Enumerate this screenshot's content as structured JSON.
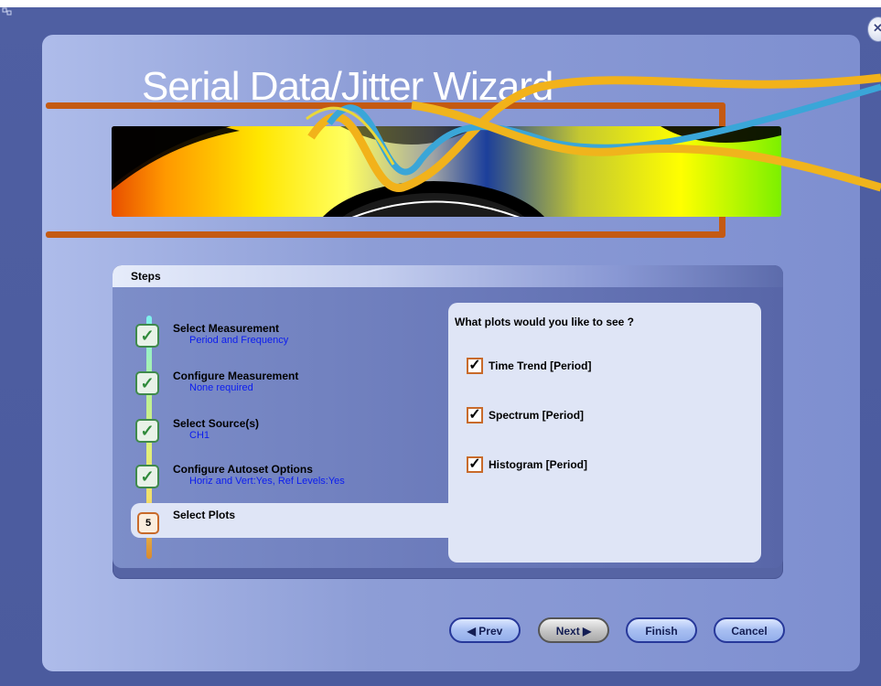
{
  "window": {
    "title": "Serial Data/Jitter Wizard",
    "close_icon": "close-icon"
  },
  "steps": {
    "header": "Steps",
    "items": [
      {
        "title": "Select Measurement",
        "subtitle": "Period and Frequency",
        "status": "complete"
      },
      {
        "title": "Configure Measurement",
        "subtitle": "None required",
        "status": "complete"
      },
      {
        "title": "Select Source(s)",
        "subtitle": "CH1",
        "status": "complete"
      },
      {
        "title": "Configure Autoset Options",
        "subtitle": "Horiz and Vert:Yes, Ref Levels:Yes",
        "status": "complete"
      },
      {
        "title": "Select Plots",
        "number": "5",
        "status": "current"
      }
    ]
  },
  "plots": {
    "question": "What plots would you like to see ?",
    "options": [
      {
        "label": "Time Trend [Period]",
        "checked": true
      },
      {
        "label": "Spectrum [Period]",
        "checked": true
      },
      {
        "label": "Histogram [Period]",
        "checked": true
      }
    ]
  },
  "buttons": {
    "prev": "◀ Prev",
    "next": "Next ▶",
    "finish": "Finish",
    "cancel": "Cancel"
  },
  "colors": {
    "accent_orange": "#c45a12",
    "subtitle_blue": "#0b1cf0",
    "check_green": "#2f8a3a"
  }
}
